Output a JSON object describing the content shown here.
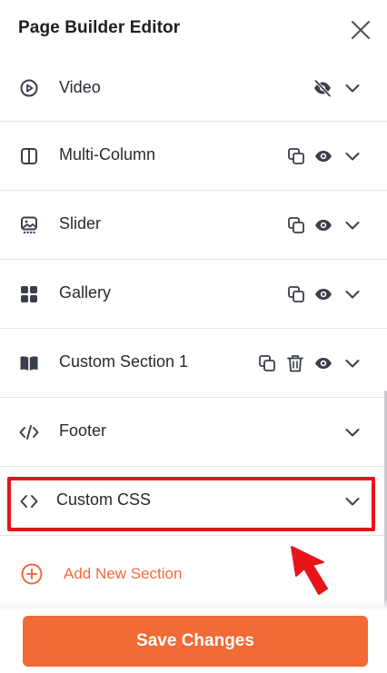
{
  "header": {
    "title": "Page Builder Editor",
    "close_icon": "close-icon"
  },
  "sections": [
    {
      "label": "Video",
      "icon": "play-circle-icon",
      "actions": [
        "eye-off-icon",
        "chevron-down-icon"
      ]
    },
    {
      "label": "Multi-Column",
      "icon": "columns-icon",
      "actions": [
        "duplicate-icon",
        "eye-icon",
        "chevron-down-icon"
      ]
    },
    {
      "label": "Slider",
      "icon": "slider-image-icon",
      "actions": [
        "duplicate-icon",
        "eye-icon",
        "chevron-down-icon"
      ]
    },
    {
      "label": "Gallery",
      "icon": "grid-icon",
      "actions": [
        "duplicate-icon",
        "eye-icon",
        "chevron-down-icon"
      ]
    },
    {
      "label": "Custom Section 1",
      "icon": "book-icon",
      "actions": [
        "duplicate-icon",
        "trash-icon",
        "eye-icon",
        "chevron-down-icon"
      ]
    },
    {
      "label": "Footer",
      "icon": "code-icon",
      "actions": [
        "chevron-down-icon"
      ]
    },
    {
      "label": "Custom CSS",
      "icon": "angle-brackets-icon",
      "actions": [
        "chevron-down-icon"
      ],
      "highlighted": true
    }
  ],
  "add_section": {
    "label": "Add New Section",
    "icon": "plus-circle-icon"
  },
  "save_button": {
    "label": "Save Changes"
  },
  "colors": {
    "accent": "#f26a35",
    "highlight": "#e8131b",
    "text": "#262a33",
    "divider": "#e3e4e8",
    "icon": "#3a3f4b"
  }
}
